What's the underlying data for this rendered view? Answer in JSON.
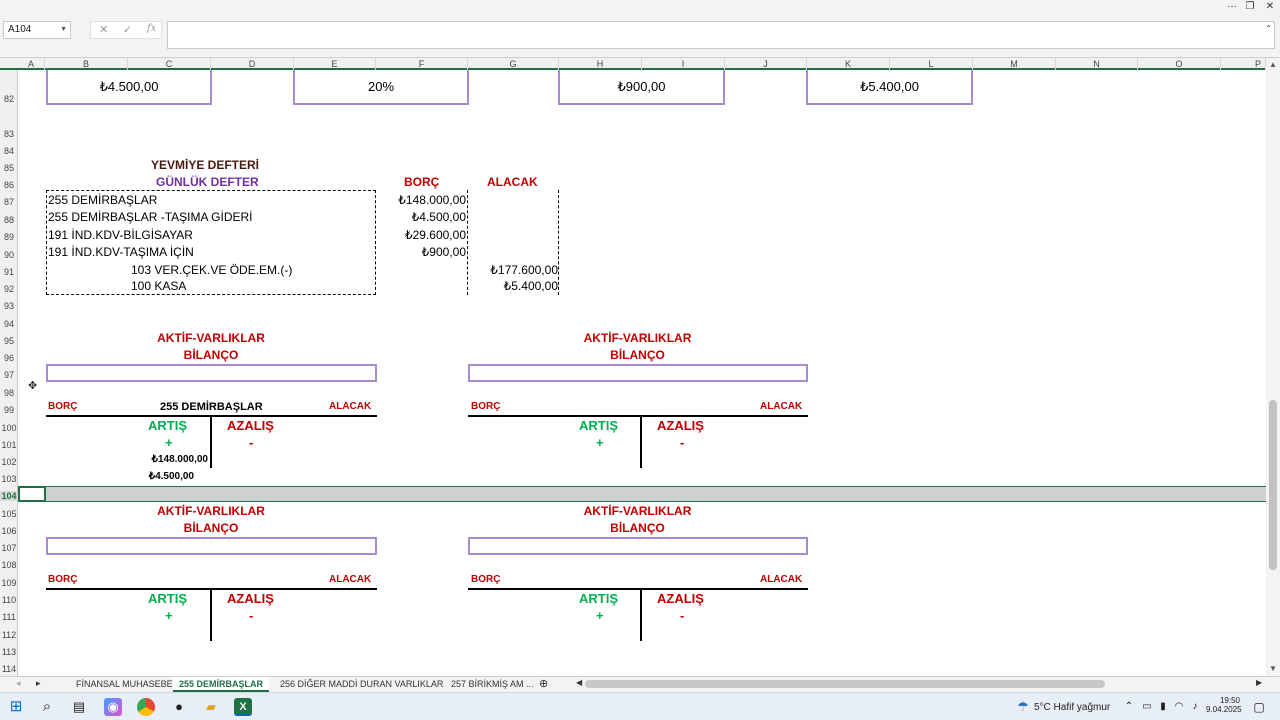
{
  "window": {
    "menu_dots": "···"
  },
  "formula_bar": {
    "name_box": "A104",
    "cancel_glyph": "✕",
    "enter_glyph": "✓",
    "fx_glyph": "fx",
    "formula": ""
  },
  "columns": [
    "A",
    "B",
    "C",
    "D",
    "E",
    "F",
    "G",
    "H",
    "I",
    "J",
    "K",
    "L",
    "M",
    "N",
    "O",
    "P"
  ],
  "rows": [
    "82",
    "83",
    "84",
    "85",
    "86",
    "87",
    "88",
    "89",
    "90",
    "91",
    "92",
    "93",
    "94",
    "95",
    "96",
    "97",
    "98",
    "99",
    "100",
    "101",
    "102",
    "103",
    "104",
    "105",
    "106",
    "107",
    "108",
    "109",
    "110",
    "111",
    "112",
    "113",
    "114"
  ],
  "top_row": {
    "box1": "₺4.500,00",
    "box2": "20%",
    "box3": "₺900,00",
    "box4": "₺5.400,00"
  },
  "journal": {
    "title": "YEVMİYE DEFTERİ",
    "subtitle": "GÜNLÜK DEFTER",
    "debit_header": "BORÇ",
    "credit_header": "ALACAK",
    "lines": [
      {
        "account": "255 DEMİRBAŞLAR",
        "debit": "₺148.000,00",
        "credit": ""
      },
      {
        "account": "255 DEMİRBAŞLAR -TAŞIMA GİDERİ",
        "debit": "₺4.500,00",
        "credit": ""
      },
      {
        "account": "191 İND.KDV-BİLGİSAYAR",
        "debit": "₺29.600,00",
        "credit": ""
      },
      {
        "account": "191 İND.KDV-TAŞIMA İÇİN",
        "debit": "₺900,00",
        "credit": ""
      },
      {
        "account": "103 VER.ÇEK.VE ÖDE.EM.(-)",
        "debit": "",
        "credit": "₺177.600,00"
      },
      {
        "account": "100 KASA",
        "debit": "",
        "credit": "₺5.400,00"
      }
    ]
  },
  "t_accounts": [
    {
      "heading1": "AKTİF-VARLIKLAR",
      "heading2": "BİLANÇO",
      "left": "BORÇ",
      "name": "255 DEMİRBAŞLAR",
      "right": "ALACAK",
      "increase": "ARTIŞ",
      "plus": "+",
      "decrease": "AZALIŞ",
      "minus": "-",
      "entries": [
        "₺148.000,00",
        "₺4.500,00"
      ]
    },
    {
      "heading1": "AKTİF-VARLIKLAR",
      "heading2": "BİLANÇO",
      "left": "BORÇ",
      "name": "",
      "right": "ALACAK",
      "increase": "ARTIŞ",
      "plus": "+",
      "decrease": "AZALIŞ",
      "minus": "-",
      "entries": []
    },
    {
      "heading1": "AKTİF-VARLIKLAR",
      "heading2": "BİLANÇO",
      "left": "BORÇ",
      "name": "",
      "right": "ALACAK",
      "increase": "ARTIŞ",
      "plus": "+",
      "decrease": "AZALIŞ",
      "minus": "-",
      "entries": []
    },
    {
      "heading1": "AKTİF-VARLIKLAR",
      "heading2": "BİLANÇO",
      "left": "BORÇ",
      "name": "",
      "right": "ALACAK",
      "increase": "ARTIŞ",
      "plus": "+",
      "decrease": "AZALIŞ",
      "minus": "-",
      "entries": []
    }
  ],
  "sheet_tabs": [
    "FİNANSAL MUHASEBE",
    "255 DEMİRBAŞLAR",
    "256 DİĞER MADDİ DURAN VARLIKLAR",
    "257 BİRİKMİŞ AM ..."
  ],
  "active_tab": "255 DEMİRBAŞLAR",
  "sheet_nav": {
    "prev": "◂",
    "next": "▸",
    "add": "⊕"
  },
  "taskbar": {
    "weather": "5°C  Hafif yağmur",
    "time": "19:50",
    "date": "9.04.2025",
    "start": "⊞",
    "search": "⌕"
  },
  "colors": {
    "red": "#c00000",
    "purple": "#7030a0",
    "green": "#00b050",
    "box_border": "#a78bd0",
    "excel_green": "#1e7145"
  }
}
